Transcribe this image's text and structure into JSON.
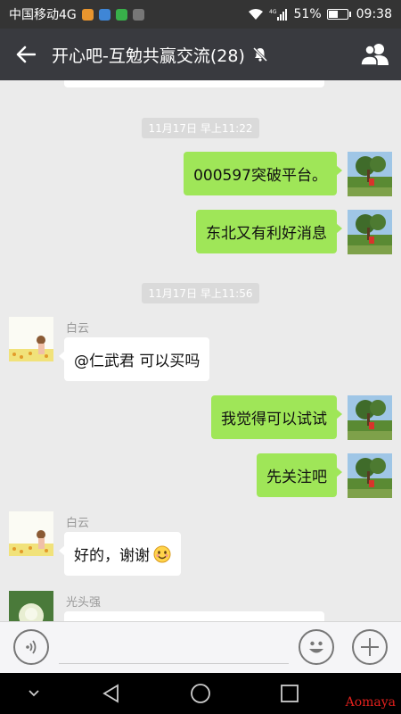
{
  "status_bar": {
    "carrier": "中国移动4G",
    "network": "4G",
    "battery": "51%",
    "battery_level": 0.51,
    "time": "09:38"
  },
  "header": {
    "title": "开心吧-互勉共赢交流(28)",
    "back_icon": "arrow-left-icon",
    "mute_icon": "bell-muted-icon",
    "members_icon": "group-members-icon"
  },
  "messages": {
    "ts1": "11月17日 早上11:22",
    "m1": "000597突破平台。",
    "m2": "东北又有利好消息",
    "ts2": "11月17日 早上11:56",
    "sender1": "白云",
    "m3": "@仁武君 可以买吗",
    "m4": "我觉得可以试试",
    "m5": "先关注吧",
    "sender2": "白云",
    "m6": "好的，谢谢",
    "sender3": "光头强"
  },
  "input_bar": {
    "voice_icon": "voice-icon",
    "emoji_icon": "emoji-icon",
    "plus_icon": "plus-icon"
  },
  "watermark": "Aomaya",
  "colors": {
    "outgoing_bubble": "#9fe658",
    "incoming_bubble": "#ffffff",
    "header_bg": "#393a3f",
    "chat_bg": "#ebebeb"
  }
}
